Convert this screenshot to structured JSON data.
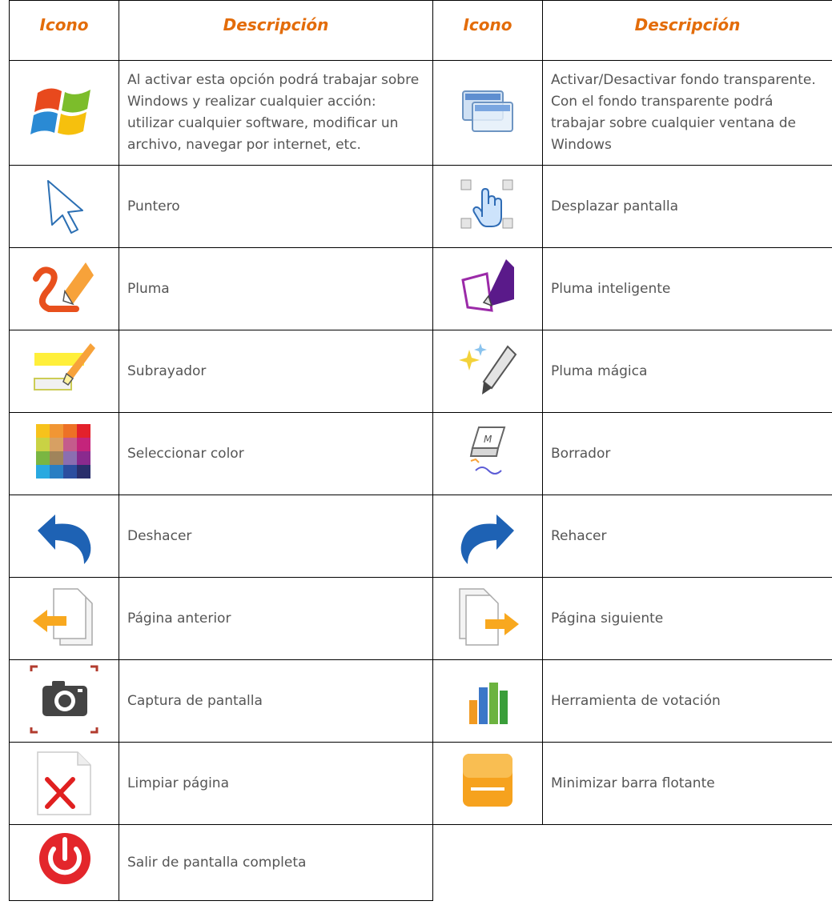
{
  "header": {
    "col1": "Icono",
    "col2": "Descripción",
    "col3": "Icono",
    "col4": "Descripción"
  },
  "rows": [
    {
      "left": {
        "icon": "windows-logo-icon",
        "desc": "Al activar esta opción podrá trabajar sobre Windows y realizar cualquier acción: utilizar cualquier software, modificar un archivo, navegar por internet, etc."
      },
      "right": {
        "icon": "transparent-background-icon",
        "desc": "Activar/Desactivar fondo transparente. Con el fondo transparente podrá trabajar sobre cualquier ventana de Windows"
      }
    },
    {
      "left": {
        "icon": "pointer-icon",
        "desc": "Puntero"
      },
      "right": {
        "icon": "pan-hand-icon",
        "desc": "Desplazar pantalla"
      }
    },
    {
      "left": {
        "icon": "pen-icon",
        "desc": "Pluma"
      },
      "right": {
        "icon": "smart-pen-icon",
        "desc": "Pluma inteligente"
      }
    },
    {
      "left": {
        "icon": "highlighter-icon",
        "desc": "Subrayador"
      },
      "right": {
        "icon": "magic-pen-icon",
        "desc": "Pluma mágica"
      }
    },
    {
      "left": {
        "icon": "color-palette-icon",
        "desc": "Seleccionar color"
      },
      "right": {
        "icon": "eraser-icon",
        "desc": "Borrador"
      }
    },
    {
      "left": {
        "icon": "undo-icon",
        "desc": "Deshacer"
      },
      "right": {
        "icon": "redo-icon",
        "desc": "Rehacer"
      }
    },
    {
      "left": {
        "icon": "previous-page-icon",
        "desc": "Página anterior"
      },
      "right": {
        "icon": "next-page-icon",
        "desc": "Página siguiente"
      }
    },
    {
      "left": {
        "icon": "camera-icon",
        "desc": "Captura de pantalla"
      },
      "right": {
        "icon": "bar-chart-icon",
        "desc": "Herramienta de votación"
      }
    },
    {
      "left": {
        "icon": "clear-page-icon",
        "desc": "Limpiar página"
      },
      "right": {
        "icon": "minimize-icon",
        "desc": "Minimizar barra flotante"
      }
    },
    {
      "left": {
        "icon": "power-icon",
        "desc": "Salir de pantalla completa"
      },
      "right": {
        "icon": "",
        "desc": ""
      }
    }
  ]
}
